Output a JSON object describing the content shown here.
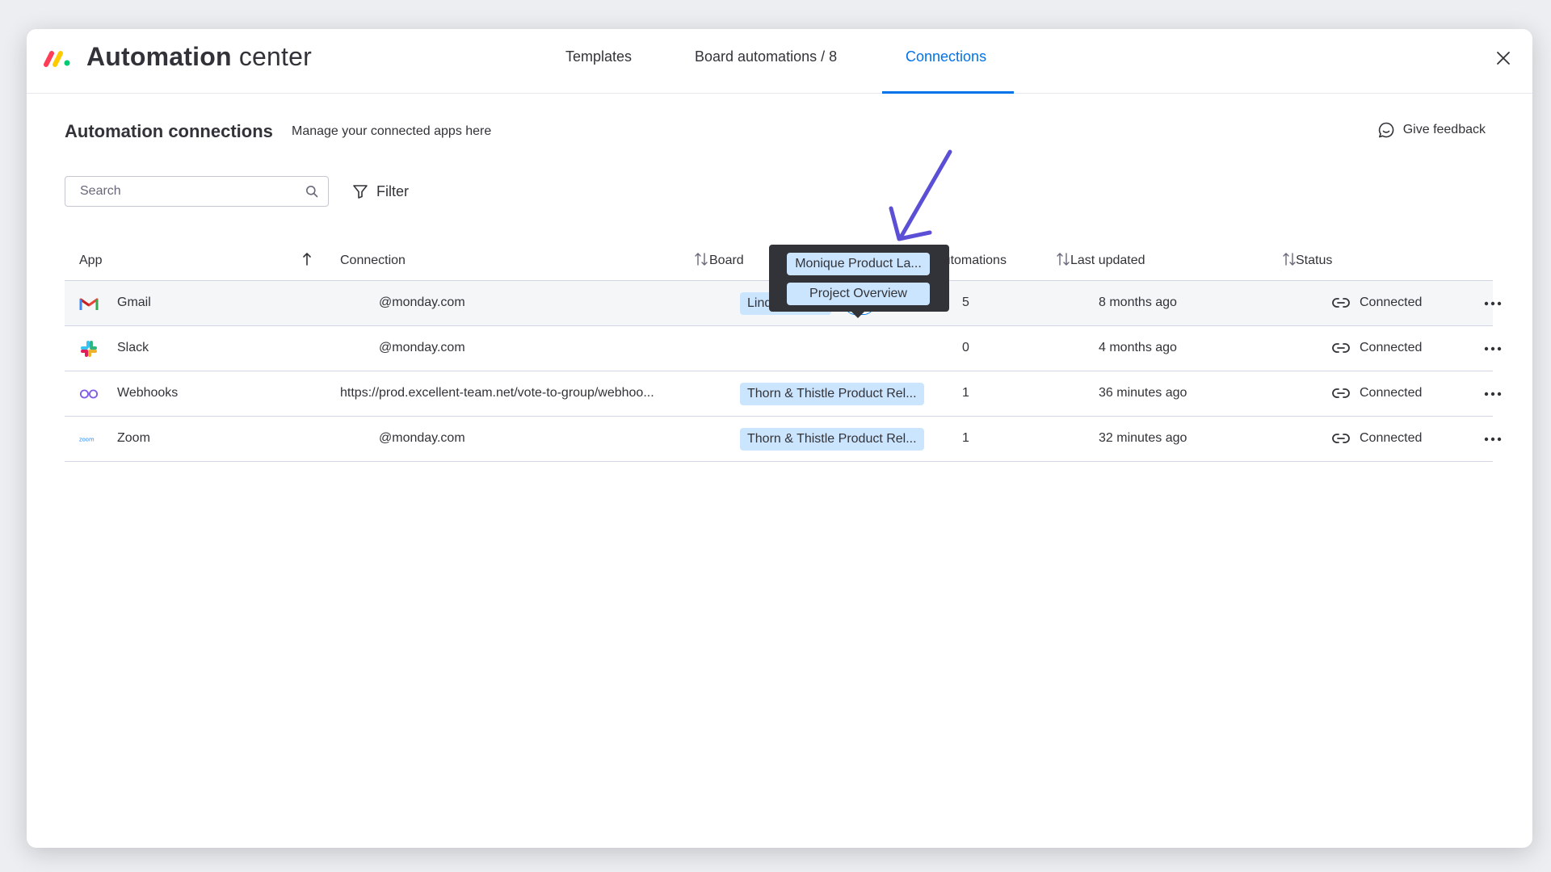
{
  "header": {
    "title_bold": "Automation",
    "title_light": "center",
    "tabs": [
      {
        "label": "Templates"
      },
      {
        "label": "Board automations / 8"
      },
      {
        "label": "Connections",
        "active": true
      }
    ],
    "close_icon": "close-icon"
  },
  "section": {
    "title": "Automation connections",
    "subtitle": "Manage your connected apps here",
    "feedback_label": "Give feedback"
  },
  "toolbar": {
    "search_placeholder": "Search",
    "filter_label": "Filter"
  },
  "table": {
    "columns": {
      "app": "App",
      "connection": "Connection",
      "boards": "Board",
      "automations": "Automations",
      "last_updated": "Last updated",
      "status": "Status"
    },
    "rows": [
      {
        "app": "Gmail",
        "icon": "gmail-icon",
        "connection": "@monday.com",
        "board": "Lindy' Library",
        "extra_boards": "+2",
        "automations": "5",
        "last_updated": "8 months ago",
        "status": "Connected"
      },
      {
        "app": "Slack",
        "icon": "slack-icon",
        "connection": "@monday.com",
        "board": "",
        "automations": "0",
        "last_updated": "4 months ago",
        "status": "Connected"
      },
      {
        "app": "Webhooks",
        "icon": "webhooks-icon",
        "connection": "https://prod.excellent-team.net/vote-to-group/webhoo...",
        "board": "Thorn & Thistle Product Rel...",
        "automations": "1",
        "last_updated": "36 minutes ago",
        "status": "Connected"
      },
      {
        "app": "Zoom",
        "icon": "zoom-icon",
        "connection": "@monday.com",
        "board": "Thorn & Thistle Product Rel...",
        "automations": "1",
        "last_updated": "32 minutes ago",
        "status": "Connected"
      }
    ]
  },
  "tooltip": {
    "items": [
      "Monique Product La...",
      "Project Overview"
    ]
  },
  "colors": {
    "accent": "#0073ea",
    "chip": "#cce5ff",
    "tooltip_bg": "#323338",
    "annotation_arrow": "#5b4fd6"
  }
}
